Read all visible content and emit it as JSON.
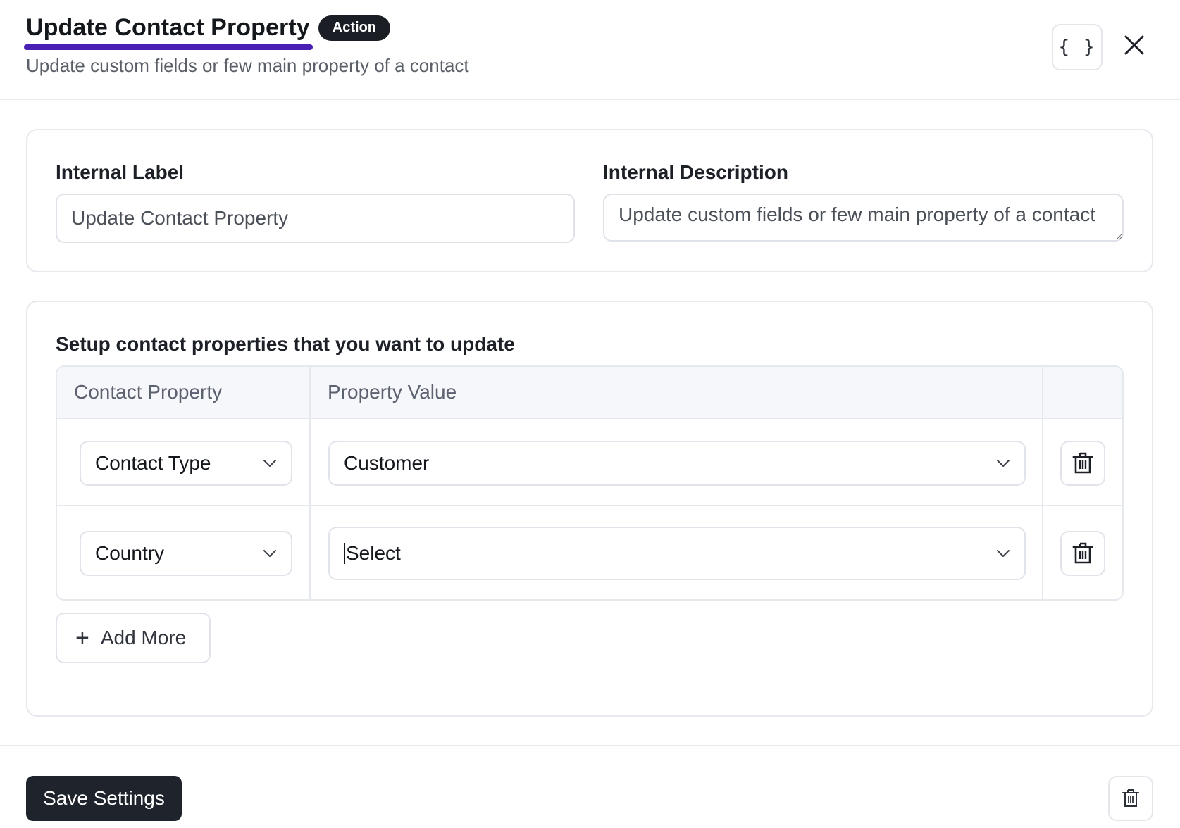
{
  "header": {
    "title": "Update Contact Property",
    "badge": "Action",
    "subtitle": "Update custom fields or few main property of a contact",
    "json_button_label": "{ }"
  },
  "settings": {
    "internal_label": {
      "label": "Internal Label",
      "value": "Update Contact Property"
    },
    "internal_description": {
      "label": "Internal Description",
      "value": "Update custom fields or few main property of a contact"
    }
  },
  "properties_section": {
    "title": "Setup contact properties that you want to update",
    "columns": [
      "Contact Property",
      "Property Value",
      ""
    ],
    "rows": [
      {
        "property": "Contact Type",
        "value": "Customer"
      },
      {
        "property": "Country",
        "value": "Select"
      }
    ],
    "add_more_label": "Add More",
    "add_more_icon": "+"
  },
  "footer": {
    "save_label": "Save Settings"
  },
  "colors": {
    "accent_underline": "#4a1fb3",
    "badge_bg": "#1b1e24",
    "primary_button": "#1f232b"
  }
}
